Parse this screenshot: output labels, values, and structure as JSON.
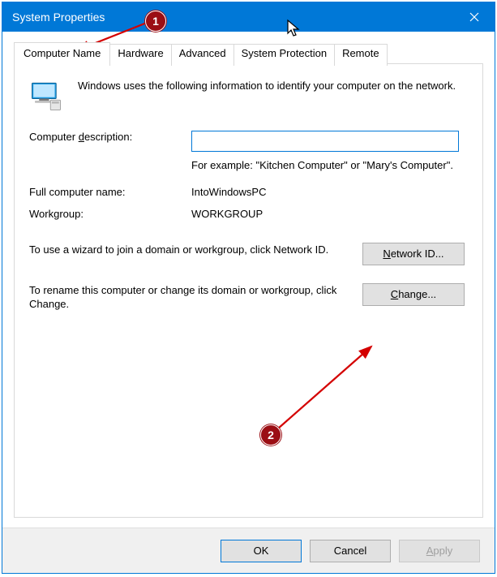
{
  "window": {
    "title": "System Properties"
  },
  "tabs": {
    "items": [
      {
        "label": "Computer Name",
        "active": true
      },
      {
        "label": "Hardware"
      },
      {
        "label": "Advanced"
      },
      {
        "label": "System Protection"
      },
      {
        "label": "Remote"
      }
    ]
  },
  "intro": "Windows uses the following information to identify your computer on the network.",
  "fields": {
    "description_label": "Computer description:",
    "description_value": "",
    "description_hint": "For example: \"Kitchen Computer\" or \"Mary's Computer\".",
    "fullname_label": "Full computer name:",
    "fullname_value": "IntoWindowsPC",
    "workgroup_label": "Workgroup:",
    "workgroup_value": "WORKGROUP"
  },
  "networkid": {
    "text": "To use a wizard to join a domain or workgroup, click Network ID.",
    "button_pre": "",
    "button_u": "N",
    "button_post": "etwork ID..."
  },
  "change": {
    "text": "To rename this computer or change its domain or workgroup, click Change.",
    "button_u": "C",
    "button_post": "hange..."
  },
  "footer": {
    "ok": "OK",
    "cancel": "Cancel",
    "apply_u": "A",
    "apply_post": "pply"
  },
  "annotations": {
    "badge1": "1",
    "badge2": "2"
  }
}
